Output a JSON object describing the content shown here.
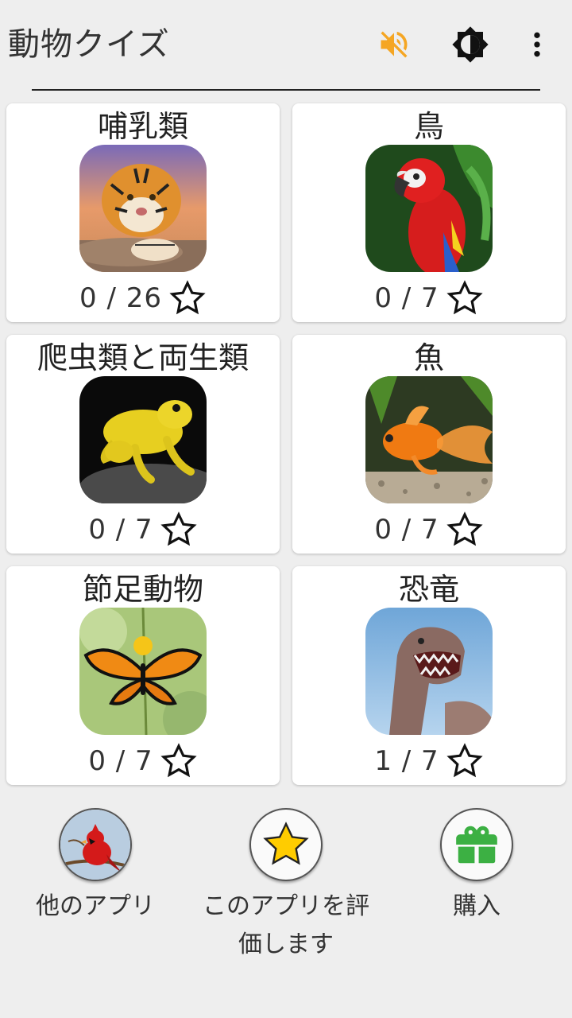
{
  "app_bar": {
    "title": "動物クイズ",
    "icons": [
      "sound-muted-icon",
      "brightness-icon",
      "more-vert-icon"
    ],
    "accent_color": "#f5a623"
  },
  "categories": [
    {
      "name": "哺乳類",
      "score": "0 / 26",
      "icon": "tiger-image"
    },
    {
      "name": "鳥",
      "score": "0 / 7",
      "icon": "parrot-image"
    },
    {
      "name": "爬虫類と両生類",
      "score": "0 / 7",
      "icon": "frog-image"
    },
    {
      "name": "魚",
      "score": "0 / 7",
      "icon": "goldfish-image"
    },
    {
      "name": "節足動物",
      "score": "0 / 7",
      "icon": "butterfly-image"
    },
    {
      "name": "恐竜",
      "score": "1 / 7",
      "icon": "dinosaur-image"
    }
  ],
  "bottom": {
    "other_apps": "他のアプリ",
    "rate_app_line1": "このアプリを評",
    "rate_app_line2": "価します",
    "purchase": "購入"
  },
  "colors": {
    "background": "#eeeeee",
    "card": "#ffffff",
    "star_gold": "#ffcc00",
    "gift_green": "#3cb043"
  }
}
